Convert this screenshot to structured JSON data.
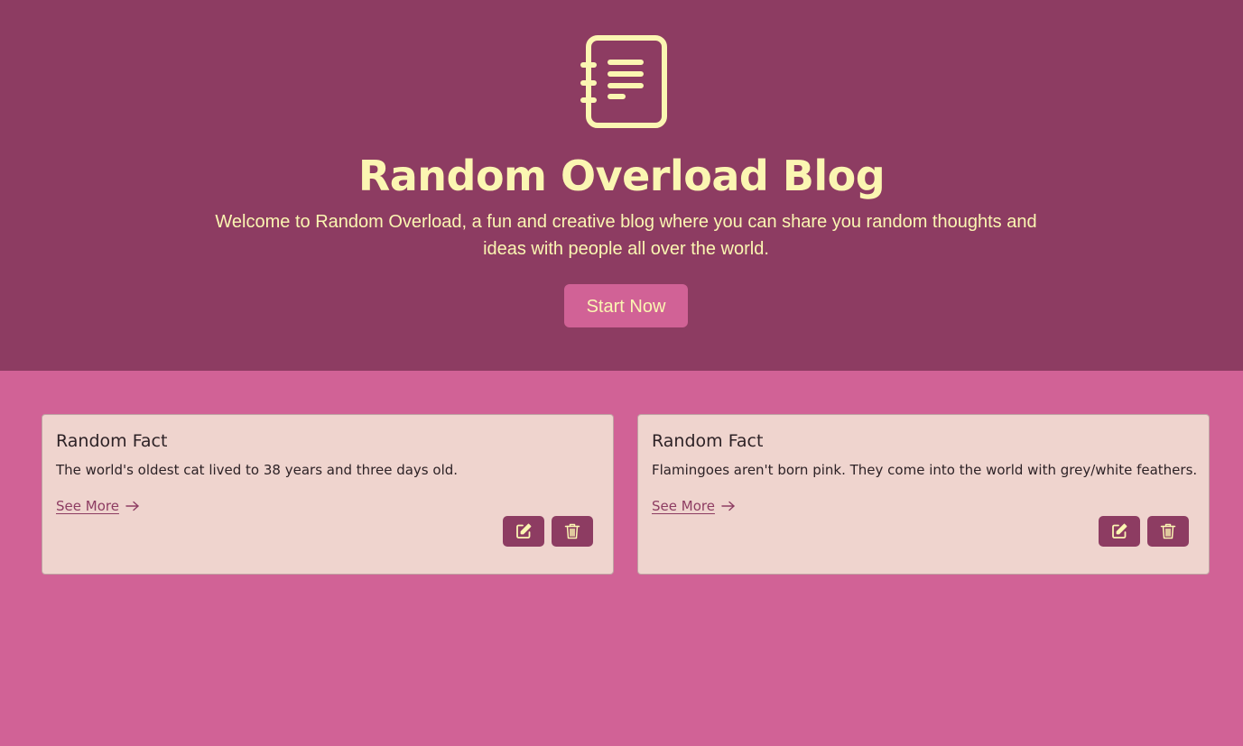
{
  "hero": {
    "title": "Random Overload Blog",
    "subtitle": "Welcome to Random Overload, a fun and creative blog where you can share you random thoughts and ideas with people all over the world.",
    "cta_label": "Start Now",
    "icon": "journal-icon"
  },
  "posts": [
    {
      "title": "Random Fact",
      "text": "The world's oldest cat lived to 38 years and three days old.",
      "link_label": "See More",
      "edit_icon": "edit-icon",
      "delete_icon": "trash-icon"
    },
    {
      "title": "Random Fact",
      "text": "Flamingoes aren't born pink. They come into the world with grey/white feathers.",
      "link_label": "See More",
      "edit_icon": "edit-icon",
      "delete_icon": "trash-icon"
    }
  ],
  "colors": {
    "hero_bg": "#8d3c62",
    "page_bg": "#d16296",
    "accent_text": "#fbf6b2",
    "card_bg": "#efd4ce"
  }
}
